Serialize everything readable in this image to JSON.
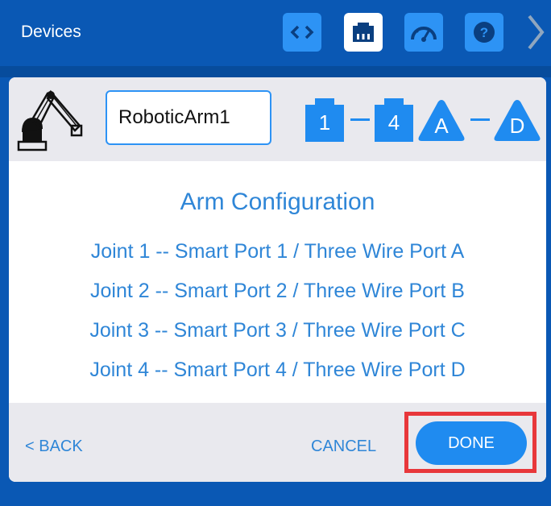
{
  "header": {
    "title": "Devices",
    "toolbar": [
      {
        "name": "code-icon",
        "active": false
      },
      {
        "name": "port-icon",
        "active": true
      },
      {
        "name": "dashboard-icon",
        "active": false
      },
      {
        "name": "help-icon",
        "active": false
      }
    ],
    "next_icon": "chevron-right-icon"
  },
  "device": {
    "icon": "robotic-arm-icon",
    "name": "RoboticArm1",
    "smart_port_start": "1",
    "smart_port_end": "4",
    "three_wire_start": "A",
    "three_wire_end": "D"
  },
  "config": {
    "title": "Arm Configuration",
    "joints": [
      "Joint 1 -- Smart Port 1 / Three Wire Port A",
      "Joint 2 -- Smart Port 2 / Three Wire Port B",
      "Joint 3 -- Smart Port 3 / Three Wire Port C",
      "Joint 4 -- Smart Port 4 / Three Wire Port D"
    ]
  },
  "footer": {
    "back_label": "< BACK",
    "cancel_label": "CANCEL",
    "done_label": "DONE"
  },
  "colors": {
    "header_bg": "#0a58b4",
    "accent": "#1f8bf0",
    "text_blue": "#2f86d7",
    "highlight": "#e8373b"
  }
}
